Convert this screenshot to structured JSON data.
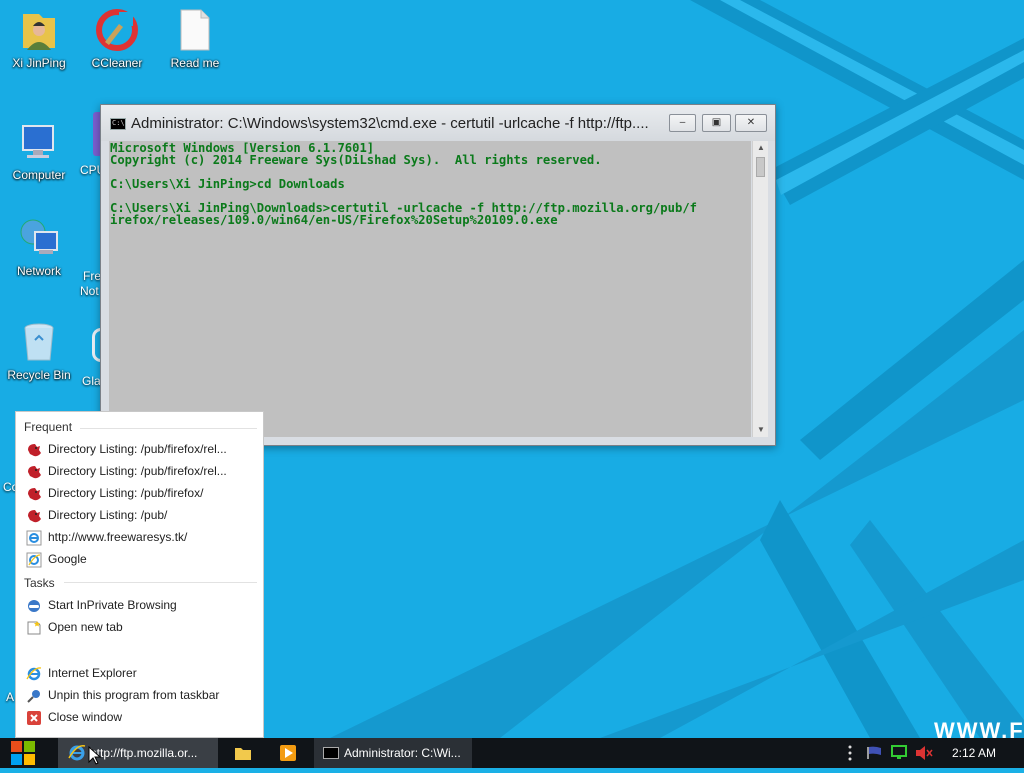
{
  "desktop": {
    "icons": [
      {
        "label": "Xi JinPing"
      },
      {
        "label": "CCleaner"
      },
      {
        "label": "Read me"
      },
      {
        "label": "Computer"
      },
      {
        "label": "Network"
      },
      {
        "label": "Recycle Bin"
      }
    ],
    "partial_labels": [
      "CPU",
      "Fre",
      "Not",
      "Gla",
      "Co",
      "A"
    ],
    "watermark": "WWW.FR"
  },
  "cmd_window": {
    "title": "Administrator: C:\\Windows\\system32\\cmd.exe - certutil  -urlcache -f http://ftp....",
    "buttons": {
      "minimize": "–",
      "restore": "▣",
      "close": "✕"
    },
    "console_lines": [
      "Microsoft Windows [Version 6.1.7601]",
      "Copyright (c) 2014 Freeware Sys(DiLshad Sys).  All rights reserved.",
      "",
      "C:\\Users\\Xi JinPing>cd Downloads",
      "",
      "C:\\Users\\Xi JinPing\\Downloads>certutil -urlcache -f http://ftp.mozilla.org/pub/f",
      "irefox/releases/109.0/win64/en-US/Firefox%20Setup%20109.0.exe"
    ]
  },
  "jumplist": {
    "frequent_header": "Frequent",
    "frequent": [
      {
        "label": "Directory Listing: /pub/firefox/rel...",
        "icon": "firefox-page-icon"
      },
      {
        "label": "Directory Listing: /pub/firefox/rel...",
        "icon": "firefox-page-icon"
      },
      {
        "label": "Directory Listing: /pub/firefox/",
        "icon": "firefox-page-icon"
      },
      {
        "label": "Directory Listing: /pub/",
        "icon": "firefox-page-icon"
      },
      {
        "label": "http://www.freewaresys.tk/",
        "icon": "ie-page-icon"
      },
      {
        "label": "Google",
        "icon": "google-icon"
      }
    ],
    "tasks_header": "Tasks",
    "tasks": [
      {
        "label": "Start InPrivate Browsing",
        "icon": "inprivate-icon"
      },
      {
        "label": "Open new tab",
        "icon": "new-tab-icon"
      }
    ],
    "program_items": [
      {
        "label": "Internet Explorer",
        "icon": "ie-icon"
      },
      {
        "label": "Unpin this program from taskbar",
        "icon": "unpin-icon"
      },
      {
        "label": "Close window",
        "icon": "close-window-icon"
      }
    ]
  },
  "taskbar": {
    "ie_button_label": "http://ftp.mozilla.or...",
    "cmd_button_label": "Administrator: C:\\Wi...",
    "clock": "2:12 AM"
  }
}
